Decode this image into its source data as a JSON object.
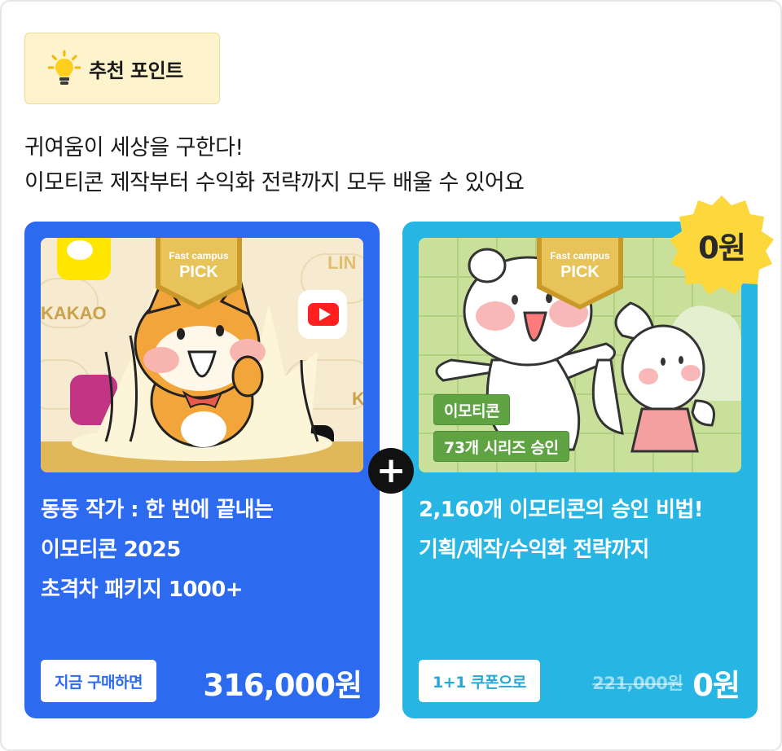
{
  "badge": {
    "label": "추천 포인트",
    "icon": "lightbulb-icon"
  },
  "intro": {
    "line1": "귀여움이 세상을 구한다!",
    "line2": "이모티콘 제작부터 수익화 전략까지 모두 배울 수 있어요"
  },
  "left_card": {
    "pick_brand": "Fast campus",
    "pick_label": "PICK",
    "bg_text": {
      "kakao": "KAKAO",
      "line": "LIN",
      "k": "K"
    },
    "title_lines": [
      "동동 작가 : 한 번에 끝내는",
      "이모티콘 2025",
      "초격차 패키지 1000+"
    ],
    "cta_label": "지금 구매하면",
    "price": "316,000원",
    "color": "#2c6af0"
  },
  "right_card": {
    "pick_brand": "Fast campus",
    "pick_label": "PICK",
    "tags": [
      "이모티콘",
      "73개 시리즈 승인"
    ],
    "title_lines": [
      "2,160개 이모티콘의 승인 비법!",
      "기획/제작/수익화 전략까지"
    ],
    "cta_label": "1+1 쿠폰으로",
    "old_price": "221,000원",
    "price": "0원",
    "color": "#27b6e3"
  },
  "plus_symbol": "+",
  "zero_badge": "0원"
}
